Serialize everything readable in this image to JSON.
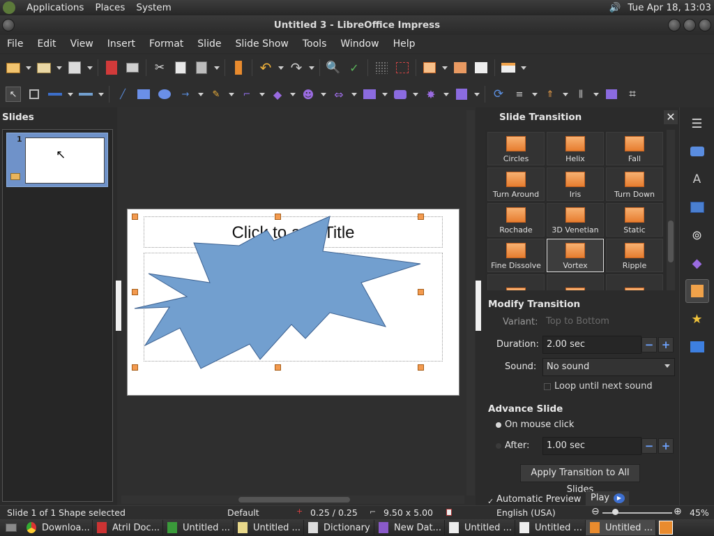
{
  "panel_top": {
    "menus": [
      "Applications",
      "Places",
      "System"
    ],
    "clock": "Tue Apr 18, 13:03"
  },
  "window": {
    "title": "Untitled 3 - LibreOffice Impress"
  },
  "menubar": [
    "File",
    "Edit",
    "View",
    "Insert",
    "Format",
    "Slide",
    "Slide Show",
    "Tools",
    "Window",
    "Help"
  ],
  "slides_pane": {
    "title": "Slides",
    "thumb_number": "1"
  },
  "slide": {
    "title_placeholder": "Click to add Title"
  },
  "transition_panel": {
    "title": "Slide Transition",
    "gallery": [
      "Circles",
      "Helix",
      "Fall",
      "Turn Around",
      "Iris",
      "Turn Down",
      "Rochade",
      "3D Venetian",
      "Static",
      "Fine Dissolve",
      "Vortex",
      "Ripple"
    ],
    "selected": "Vortex",
    "modify_heading": "Modify Transition",
    "variant_label": "Variant:",
    "variant_value": "Top to Bottom",
    "duration_label": "Duration:",
    "duration_value": "2.00 sec",
    "sound_label": "Sound:",
    "sound_value": "No sound",
    "loop_label": "Loop until next sound",
    "advance_heading": "Advance Slide",
    "mouse_click_label": "On mouse click",
    "after_label": "After:",
    "after_value": "1.00 sec",
    "apply_all_label": "Apply Transition to All Slides",
    "auto_preview_label": "Automatic Preview",
    "play_label": "Play"
  },
  "statusbar": {
    "slide_info": "Slide 1 of 1",
    "selection": "Shape selected",
    "layout": "Default",
    "position": "0.25 / 0.25",
    "size": "9.50 x 5.00",
    "language": "English (USA)",
    "zoom": "45%"
  },
  "taskbar": [
    "Downloa...",
    "Atril Doc...",
    "Untitled ...",
    "Untitled ...",
    "Dictionary",
    "New Dat...",
    "Untitled ...",
    "Untitled ...",
    "Untitled ..."
  ],
  "colors": {
    "accent": "#6f92c9",
    "shape_fill": "#729fcf",
    "gallery_orange": "#e77d2f"
  }
}
